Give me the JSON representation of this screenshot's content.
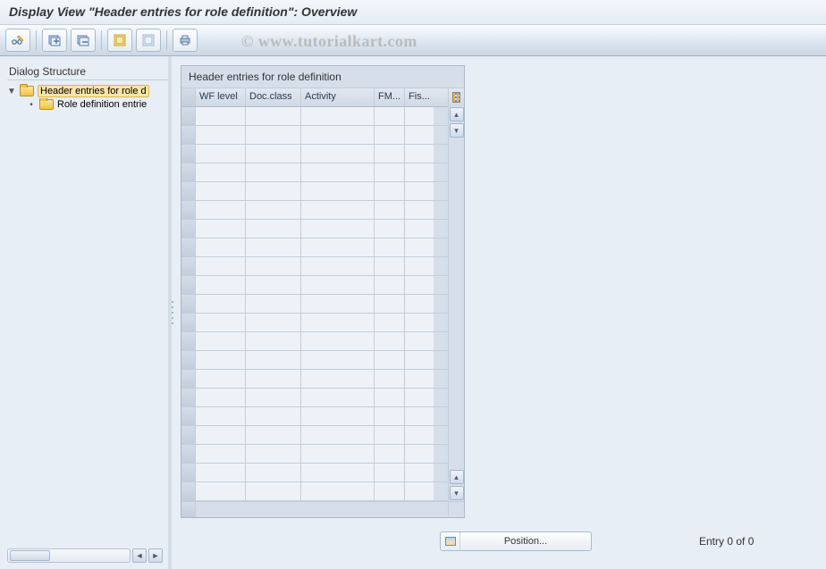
{
  "title": "Display View \"Header entries for role definition\": Overview",
  "watermark": "© www.tutorialkart.com",
  "tree": {
    "header": "Dialog Structure",
    "root_label": "Header entries for role d",
    "child_label": "Role definition entrie"
  },
  "table": {
    "title": "Header entries for role definition",
    "columns": {
      "c1": "WF level",
      "c2": "Doc.class",
      "c3": "Activity",
      "c4": "FM...",
      "c5": "Fis..."
    },
    "row_count": 21
  },
  "footer": {
    "position_label": "Position...",
    "entry_counter": "Entry 0 of 0"
  }
}
